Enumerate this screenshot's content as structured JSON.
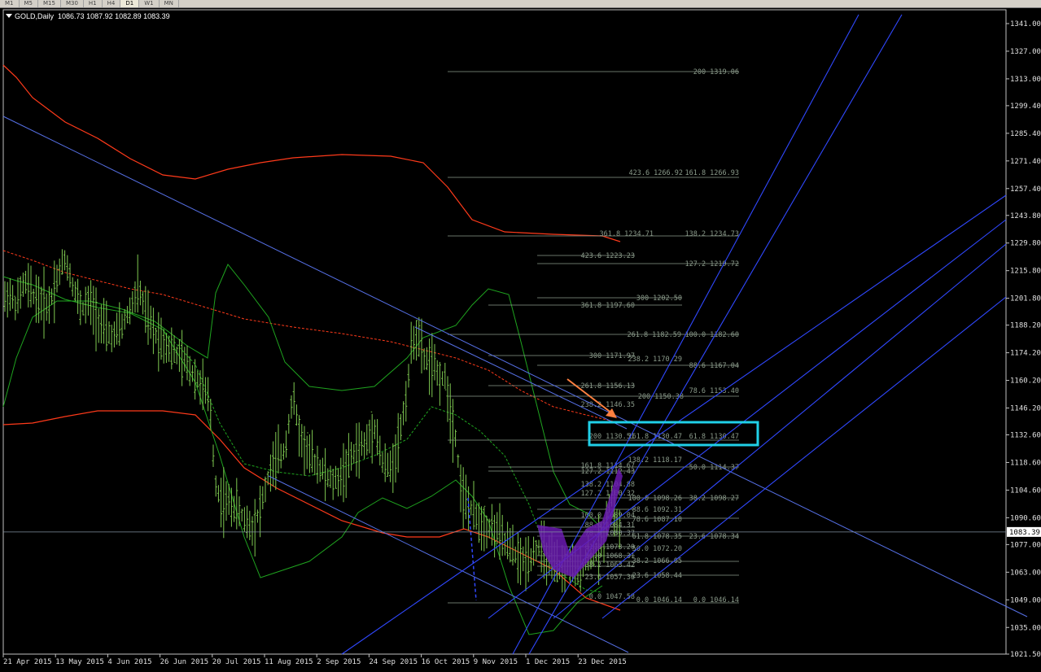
{
  "timeframes": [
    "M1",
    "M5",
    "M15",
    "M30",
    "H1",
    "H4",
    "D1",
    "W1",
    "MN"
  ],
  "active_timeframe": "D1",
  "symbol": "GOLD,Daily",
  "ohlc": "1086.73 1087.92 1082.89 1083.39",
  "current_price": "1083.39",
  "colors": {
    "background": "#000000",
    "candles": "#7ec850",
    "fib": "#8a9a8a",
    "trend": "#3048ff",
    "channel": "#5670e6",
    "bb_outer": "#ff3a1a",
    "bb_inner": "#1fa41f",
    "highlight": "#20d0e8",
    "arrow": "#ff8040",
    "pattern": "#6a1ab0"
  },
  "chart_data": {
    "type": "candlestick",
    "ylim": [
      1021.5,
      1348
    ],
    "y_ticks": [
      "1341.00",
      "1327.00",
      "1313.00",
      "1299.40",
      "1285.40",
      "1271.40",
      "1257.40",
      "1243.80",
      "1229.80",
      "1215.80",
      "1201.80",
      "1188.20",
      "1174.20",
      "1160.20",
      "1146.20",
      "1132.60",
      "1118.60",
      "1104.60",
      "1090.60",
      "1077.00",
      "1063.00",
      "1049.00",
      "1035.00",
      "1021.50"
    ],
    "x_labels": [
      "21 Apr 2015",
      "13 May 2015",
      "4 Jun 2015",
      "26 Jun 2015",
      "20 Jul 2015",
      "11 Aug 2015",
      "2 Sep 2015",
      "24 Sep 2015",
      "16 Oct 2015",
      "9 Nov 2015",
      "1 Dec 2015",
      "23 Dec 2015"
    ],
    "price_path": [
      [
        0,
        1195
      ],
      [
        10,
        1205
      ],
      [
        20,
        1198
      ],
      [
        30,
        1210
      ],
      [
        40,
        1204
      ],
      [
        50,
        1200
      ],
      [
        60,
        1198
      ],
      [
        70,
        1212
      ],
      [
        80,
        1222
      ],
      [
        90,
        1208
      ],
      [
        100,
        1196
      ],
      [
        110,
        1200
      ],
      [
        120,
        1192
      ],
      [
        130,
        1185
      ],
      [
        140,
        1182
      ],
      [
        150,
        1188
      ],
      [
        160,
        1196
      ],
      [
        170,
        1208
      ],
      [
        180,
        1192
      ],
      [
        190,
        1184
      ],
      [
        200,
        1180
      ],
      [
        210,
        1176
      ],
      [
        220,
        1172
      ],
      [
        230,
        1168
      ],
      [
        240,
        1162
      ],
      [
        250,
        1156
      ],
      [
        258,
        1148
      ],
      [
        264,
        1110
      ],
      [
        270,
        1100
      ],
      [
        280,
        1098
      ],
      [
        290,
        1096
      ],
      [
        300,
        1090
      ],
      [
        310,
        1086
      ],
      [
        320,
        1095
      ],
      [
        330,
        1112
      ],
      [
        340,
        1120
      ],
      [
        350,
        1125
      ],
      [
        355,
        1140
      ],
      [
        360,
        1152
      ],
      [
        365,
        1140
      ],
      [
        370,
        1130
      ],
      [
        380,
        1122
      ],
      [
        390,
        1118
      ],
      [
        400,
        1112
      ],
      [
        410,
        1108
      ],
      [
        420,
        1112
      ],
      [
        430,
        1120
      ],
      [
        440,
        1126
      ],
      [
        450,
        1128
      ],
      [
        460,
        1138
      ],
      [
        470,
        1118
      ],
      [
        480,
        1115
      ],
      [
        490,
        1130
      ],
      [
        500,
        1155
      ],
      [
        505,
        1175
      ],
      [
        510,
        1185
      ],
      [
        515,
        1180
      ],
      [
        520,
        1172
      ],
      [
        530,
        1168
      ],
      [
        540,
        1162
      ],
      [
        548,
        1160
      ],
      [
        555,
        1140
      ],
      [
        560,
        1132
      ],
      [
        565,
        1110
      ],
      [
        570,
        1100
      ],
      [
        580,
        1094
      ],
      [
        590,
        1088
      ],
      [
        600,
        1086
      ],
      [
        610,
        1084
      ],
      [
        620,
        1078
      ],
      [
        630,
        1074
      ],
      [
        640,
        1068
      ],
      [
        650,
        1070
      ],
      [
        660,
        1076
      ],
      [
        670,
        1072
      ],
      [
        680,
        1066
      ],
      [
        690,
        1064
      ],
      [
        700,
        1068
      ],
      [
        710,
        1062
      ],
      [
        720,
        1070
      ],
      [
        730,
        1072
      ],
      [
        740,
        1078
      ],
      [
        746,
        1092
      ],
      [
        750,
        1104
      ],
      [
        754,
        1096
      ],
      [
        758,
        1088
      ],
      [
        762,
        1083
      ]
    ],
    "fib_levels": [
      [
        "200",
        "1319.06"
      ],
      [
        "423.6",
        "1266.92"
      ],
      [
        "161.8",
        "1266.93"
      ],
      [
        "361.8",
        "1234.71"
      ],
      [
        "138.2",
        "1234.73"
      ],
      [
        "423.6",
        "1223.23"
      ],
      [
        "127.2",
        "1219.72"
      ],
      [
        "300",
        "1202.50"
      ],
      [
        "361.8",
        "1197.60"
      ],
      [
        "261.8",
        "1182.59"
      ],
      [
        "100.0",
        "1182.60"
      ],
      [
        "300",
        "1171.97"
      ],
      [
        "238.2",
        "1170.29"
      ],
      [
        "88.6",
        "1167.04"
      ],
      [
        "261.8",
        "1156.13"
      ],
      [
        "78.6",
        "1153.40"
      ],
      [
        "200",
        "1150.38"
      ],
      [
        "238.2",
        "1146.35"
      ],
      [
        "200",
        "1130.51"
      ],
      [
        "161.8",
        "1130.47"
      ],
      [
        "61.8",
        "1130.47"
      ],
      [
        "138.2",
        "1118.17"
      ],
      [
        "161.8",
        "1114.67"
      ],
      [
        "50.0",
        "1114.37"
      ],
      [
        "127.2",
        "1112.43"
      ],
      [
        "138.2",
        "1104.88"
      ],
      [
        "127.2",
        "1100.32"
      ],
      [
        "100.0",
        "1098.26"
      ],
      [
        "38.2",
        "1098.27"
      ],
      [
        "88.6",
        "1092.31"
      ],
      [
        "100.0",
        "1089.04"
      ],
      [
        "78.6",
        "1087.10"
      ],
      [
        "88.6",
        "1084.31"
      ],
      [
        "78.6",
        "1080.37"
      ],
      [
        "61.8",
        "1078.35"
      ],
      [
        "23.6",
        "1078.34"
      ],
      [
        "61.8",
        "1073.20"
      ],
      [
        "50.0",
        "1072.20"
      ],
      [
        "50.0",
        "1068.31"
      ],
      [
        "38.2",
        "1066.05"
      ],
      [
        "38.2",
        "1063.42"
      ],
      [
        "23.6",
        "1058.44"
      ],
      [
        "23.6",
        "1057.36"
      ],
      [
        "0.0",
        "1047.58"
      ],
      [
        "0.0",
        "1046.14"
      ],
      [
        "0.0",
        "1046.14"
      ]
    ]
  }
}
